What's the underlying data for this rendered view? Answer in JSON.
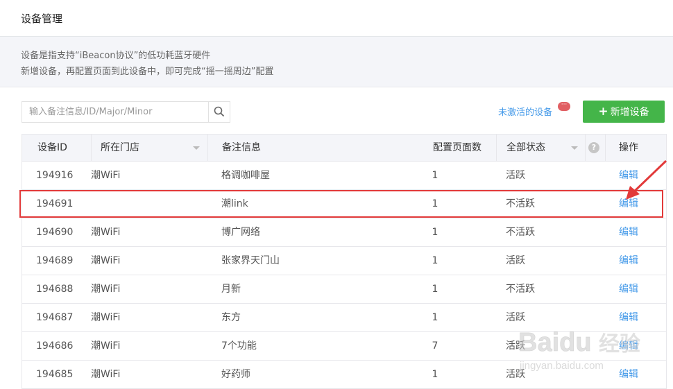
{
  "header": {
    "title": "设备管理"
  },
  "description": {
    "line1": "设备是指支持“iBeacon协议”的低功耗蓝牙硬件",
    "line2": "新增设备，再配置页面到此设备中，即可完成“摇一摇周边”配置"
  },
  "search": {
    "placeholder": "输入备注信息/ID/Major/Minor",
    "value": ""
  },
  "toolbar": {
    "inactive_link": "未激活的设备",
    "badge": "···",
    "add_label": "新增设备"
  },
  "table": {
    "columns": [
      "设备ID",
      "所在门店",
      "备注信息",
      "配置页面数",
      "全部状态",
      "操作"
    ],
    "rows": [
      {
        "id": "194916",
        "store": "潮WiFi",
        "note": "格调咖啡屋",
        "pages": "1",
        "status": "活跃",
        "op": "编辑"
      },
      {
        "id": "194691",
        "store": "",
        "note": "潮link",
        "pages": "1",
        "status": "不活跃",
        "op": "编辑"
      },
      {
        "id": "194690",
        "store": "潮WiFi",
        "note": "博广网络",
        "pages": "1",
        "status": "不活跃",
        "op": "编辑"
      },
      {
        "id": "194689",
        "store": "潮WiFi",
        "note": "张家界天门山",
        "pages": "1",
        "status": "活跃",
        "op": "编辑"
      },
      {
        "id": "194688",
        "store": "潮WiFi",
        "note": "月新",
        "pages": "1",
        "status": "不活跃",
        "op": "编辑"
      },
      {
        "id": "194687",
        "store": "潮WiFi",
        "note": "东方",
        "pages": "1",
        "status": "活跃",
        "op": "编辑"
      },
      {
        "id": "194686",
        "store": "潮WiFi",
        "note": "7个功能",
        "pages": "7",
        "status": "活跃",
        "op": "编辑"
      },
      {
        "id": "194685",
        "store": "潮WiFi",
        "note": "好药师",
        "pages": "1",
        "status": "活跃",
        "op": "编辑"
      }
    ]
  },
  "watermark": {
    "brand": "Baidu",
    "brand_suffix": "经验",
    "url": "jingyan.baidu.com"
  },
  "colors": {
    "accent_green": "#44b549",
    "link_blue": "#459ae9",
    "highlight_red": "#e23a3a"
  }
}
